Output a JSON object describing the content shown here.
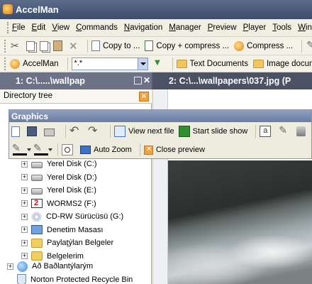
{
  "window": {
    "title": "AccelMan"
  },
  "menu": [
    "File",
    "Edit",
    "View",
    "Commands",
    "Navigation",
    "Manager",
    "Preview",
    "Player",
    "Tools",
    "Window"
  ],
  "toolbar1": {
    "copy_to": "Copy to ...",
    "copy_compress": "Copy + compress ...",
    "compress": "Compress ..."
  },
  "toolbar2": {
    "accelman_label": "AccelMan",
    "filter_value": "*.*",
    "text_documents": "Text Documents",
    "image_documents": "Image documen"
  },
  "panes": {
    "left_tab": "1: C:\\.....\\wallpap",
    "right_tab": "2: C:\\...\\wallpapers\\037.jpg (P"
  },
  "directory_tree": {
    "header": "Directory tree",
    "items": [
      {
        "label": "Yerel Disk (C:)",
        "icon": "drive-icon"
      },
      {
        "label": "Yerel Disk (D:)",
        "icon": "drive-icon"
      },
      {
        "label": "Yerel Disk (E:)",
        "icon": "drive-icon"
      },
      {
        "label": "WORMS2 (F:)",
        "icon": "worms-cd-icon"
      },
      {
        "label": "CD-RW Sürücüsü (G:)",
        "icon": "cdrw-icon"
      },
      {
        "label": "Denetim Masası",
        "icon": "control-panel-icon"
      },
      {
        "label": "Paylaţýlan Belgeler",
        "icon": "folder-icon"
      },
      {
        "label": "Belgelerim",
        "icon": "folder-icon"
      }
    ],
    "root_items": [
      {
        "label": "Að Baðlantýlarým",
        "icon": "network-icon"
      },
      {
        "label": "Norton Protected Recycle Bin",
        "icon": "recycle-bin-icon"
      }
    ]
  },
  "graphics_toolbar": {
    "title": "Graphics",
    "view_next": "View next file",
    "slide_show": "Start slide show",
    "auto_zoom": "Auto Zoom",
    "close_preview": "Close preview"
  },
  "colors": {
    "titlebar": "#4b5c7b",
    "pane_tab_active": "#6c7386",
    "close_accent": "#f0a23a"
  }
}
